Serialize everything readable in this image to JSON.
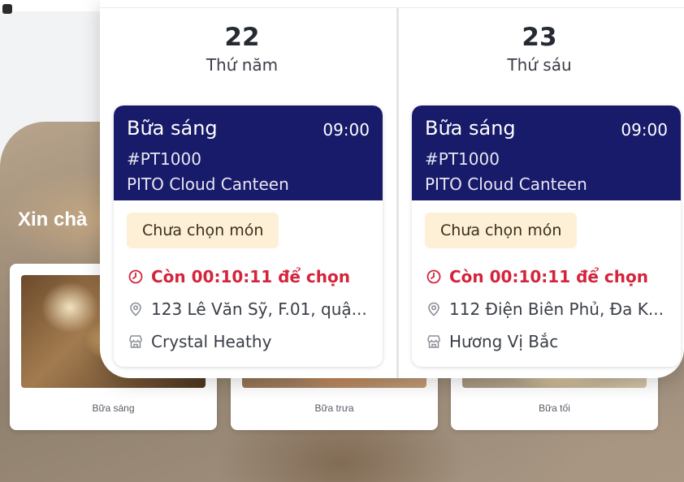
{
  "background": {
    "greeting": "Xin chà",
    "meal_cards": [
      {
        "label": "Bữa sáng"
      },
      {
        "label": "Bữa trưa"
      },
      {
        "label": "Bữa tối"
      }
    ]
  },
  "popup": {
    "days": [
      {
        "day_number": "22",
        "day_name": "Thứ năm",
        "order": {
          "meal": "Bữa sáng",
          "time": "09:00",
          "code": "#PT1000",
          "canteen": "PITO Cloud Canteen",
          "status": "Chưa chọn món",
          "countdown": "Còn 00:10:11 để chọn",
          "address": "123 Lê Văn Sỹ, F.01, quậ...",
          "restaurant": "Crystal Heathy"
        }
      },
      {
        "day_number": "23",
        "day_name": "Thứ sáu",
        "order": {
          "meal": "Bữa sáng",
          "time": "09:00",
          "code": "#PT1000",
          "canteen": "PITO Cloud Canteen",
          "status": "Chưa chọn món",
          "countdown": "Còn 00:10:11 để chọn",
          "address": "112 Điện Biên Phủ, Đa K...",
          "restaurant": "Hương Vị Bắc"
        }
      }
    ]
  },
  "colors": {
    "header_navy": "#181a6a",
    "countdown_red": "#d4243c",
    "status_pill_bg": "#fdf0d7"
  },
  "icons": {
    "countdown": "clock-icon",
    "address": "location-pin-icon",
    "restaurant": "store-icon"
  }
}
